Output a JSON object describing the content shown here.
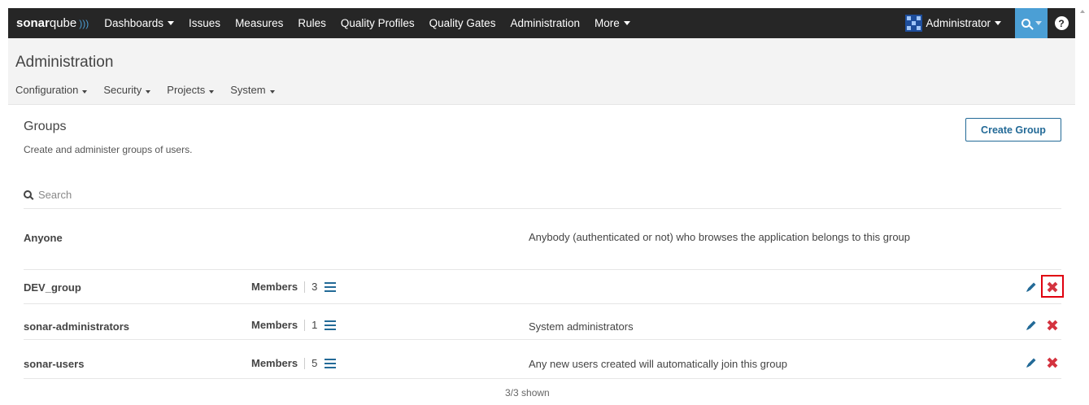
{
  "nav": {
    "brand_bold": "sonar",
    "brand_rest": "qube",
    "items": [
      {
        "label": "Dashboards",
        "dropdown": true
      },
      {
        "label": "Issues",
        "dropdown": false
      },
      {
        "label": "Measures",
        "dropdown": false
      },
      {
        "label": "Rules",
        "dropdown": false
      },
      {
        "label": "Quality Profiles",
        "dropdown": false
      },
      {
        "label": "Quality Gates",
        "dropdown": false
      },
      {
        "label": "Administration",
        "dropdown": false
      },
      {
        "label": "More",
        "dropdown": true
      }
    ],
    "user": "Administrator",
    "help_glyph": "?",
    "colors": {
      "bar": "#262626",
      "accent": "#4b9fd5"
    }
  },
  "context": {
    "title": "Administration",
    "subnav": [
      "Configuration",
      "Security",
      "Projects",
      "System"
    ]
  },
  "page": {
    "title": "Groups",
    "description": "Create and administer groups of users.",
    "create_button": "Create Group",
    "search_placeholder": "Search"
  },
  "groups": [
    {
      "name": "Anyone",
      "members_label": "",
      "members_count": "",
      "description": "Anybody (authenticated or not) who browses the application belongs to this group",
      "editable": false
    },
    {
      "name": "DEV_group",
      "members_label": "Members",
      "members_count": "3",
      "description": "",
      "editable": true,
      "highlighted_delete": true
    },
    {
      "name": "sonar-administrators",
      "members_label": "Members",
      "members_count": "1",
      "description": "System administrators",
      "editable": true
    },
    {
      "name": "sonar-users",
      "members_label": "Members",
      "members_count": "5",
      "description": "Any new users created will automatically join this group",
      "editable": true
    }
  ],
  "footer": {
    "shown": "3/3 shown"
  },
  "icons": {
    "edit": "pencil-icon",
    "delete": "delete-icon",
    "members": "list-icon",
    "search": "search-icon"
  },
  "colors": {
    "link": "#236a97",
    "delete": "#d4333f",
    "highlight": "#e0000f"
  }
}
